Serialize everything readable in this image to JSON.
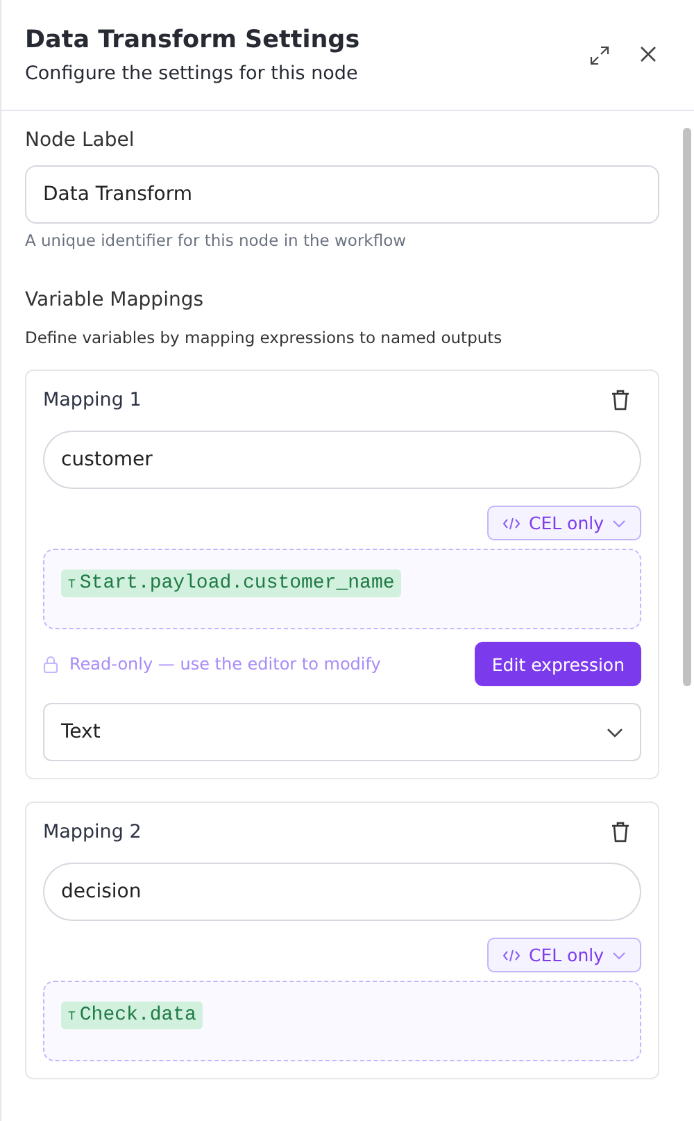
{
  "header": {
    "title": "Data Transform Settings",
    "subtitle": "Configure the settings for this node"
  },
  "node_label": {
    "label": "Node Label",
    "value": "Data Transform",
    "help": "A unique identifier for this node in the workflow"
  },
  "variable_mappings": {
    "title": "Variable Mappings",
    "description": "Define variables by mapping expressions to named outputs",
    "mappings": [
      {
        "title": "Mapping 1",
        "name": "customer",
        "mode": "CEL only",
        "type_marker": "T",
        "expression": "Start.payload.customer_name",
        "readonly_note": "Read-only — use the editor to modify",
        "edit_button": "Edit expression",
        "output_type": "Text"
      },
      {
        "title": "Mapping 2",
        "name": "decision",
        "mode": "CEL only",
        "type_marker": "T",
        "expression": "Check.data"
      }
    ]
  }
}
